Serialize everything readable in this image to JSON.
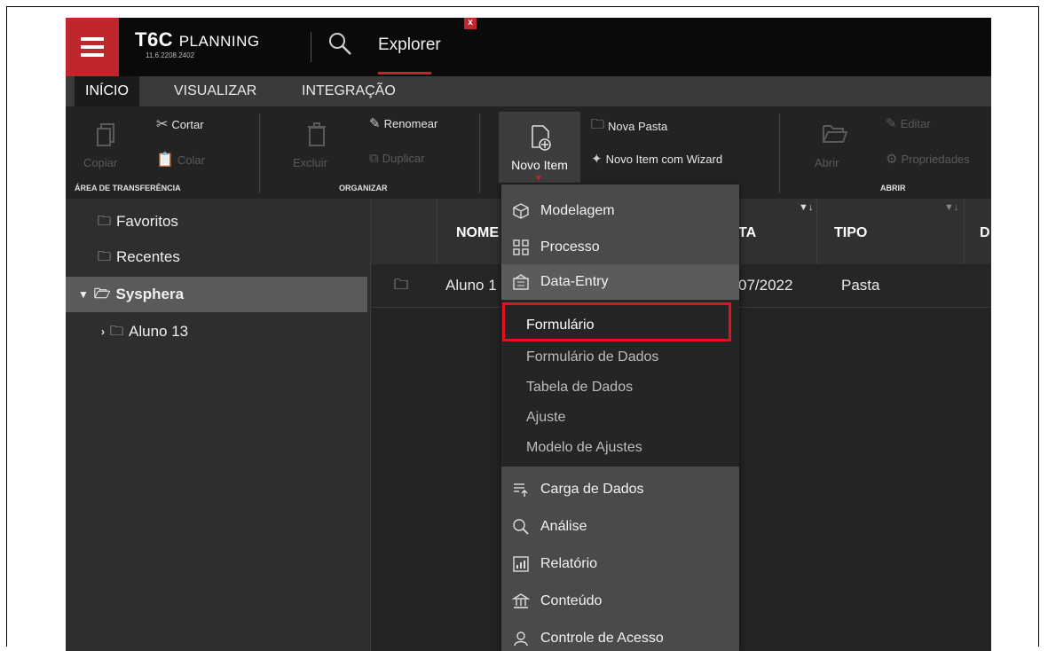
{
  "app": {
    "brand_bold": "T6C",
    "brand_light": "PLANNING",
    "version": "11.6.2208.2402",
    "active_tab": "Explorer",
    "close_glyph": "x",
    "accent_color": "#c0272d"
  },
  "menu": {
    "tabs": [
      "INÍCIO",
      "VISUALIZAR",
      "INTEGRAÇÃO"
    ]
  },
  "ribbon": {
    "copiar": "Copiar",
    "cortar": "Cortar",
    "colar": "Colar",
    "excluir": "Excluir",
    "renomear": "Renomear",
    "duplicar": "Duplicar",
    "novo_item": "Novo Item",
    "nova_pasta": "Nova Pasta",
    "novo_item_wizard": "Novo Item com Wizard",
    "abrir": "Abrir",
    "editar": "Editar",
    "propriedades": "Propriedades",
    "groups": {
      "transferencia": "ÁREA DE TRANSFERÊNCIA",
      "organizar": "ORGANIZAR",
      "abrir": "ABRIR"
    }
  },
  "sidebar": {
    "favoritos": "Favoritos",
    "recentes": "Recentes",
    "sysphera": "Sysphera",
    "aluno": "Aluno 13"
  },
  "grid": {
    "col_nome": "NOME",
    "col_data": "TA",
    "col_tipo": "TIPO",
    "col_d": "D",
    "row": {
      "nome": "Aluno 1",
      "data": "07/2022",
      "tipo": "Pasta"
    }
  },
  "dropdown": {
    "modelagem": "Modelagem",
    "processo": "Processo",
    "data_entry": "Data-Entry",
    "sub": [
      "Formulário",
      "Formulário de Dados",
      "Tabela de Dados",
      "Ajuste",
      "Modelo de Ajustes"
    ],
    "carga": "Carga de Dados",
    "analise": "Análise",
    "relatorio": "Relatório",
    "conteudo": "Conteúdo",
    "controle": "Controle de Acesso"
  }
}
